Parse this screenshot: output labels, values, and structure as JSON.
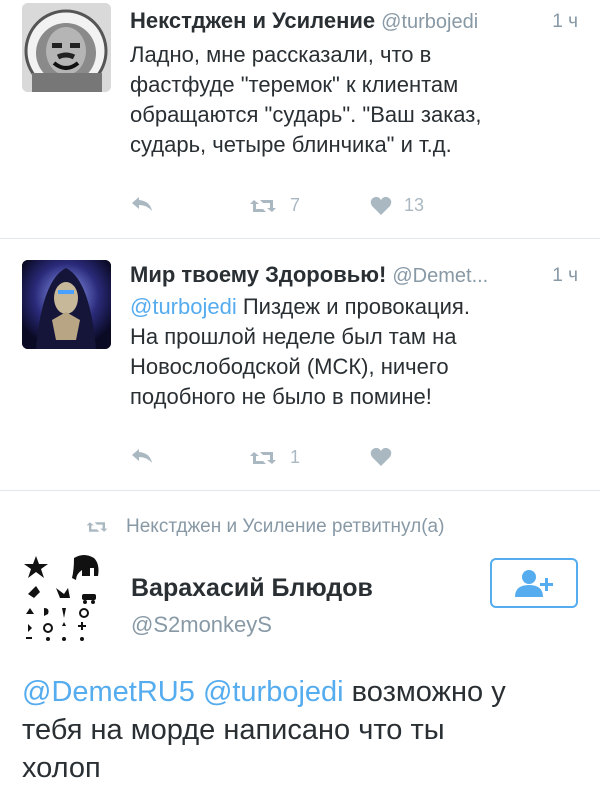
{
  "tweets": [
    {
      "name": "Некстджен и Усиление",
      "handle": "@turbojedi",
      "time": "1 ч",
      "lines": [
        "Ладно, мне рассказали, что в",
        "фастфуде \"теремок\" к клиентам",
        "обращаются \"сударь\". \"Ваш заказ,",
        "сударь, четыре блинчика\" и т.д."
      ],
      "retweets": "7",
      "likes": "13"
    },
    {
      "name": "Мир твоему Здоровью!",
      "handle": "@Demet...",
      "time": "1 ч",
      "lines": [
        "@turbojedi Пиздеж и провокация.",
        "На прошлой неделе был там на",
        "Новослободской (МСК), ничего",
        "подобного не было в помине!"
      ],
      "retweets": "1",
      "likes": ""
    }
  ],
  "retweet_header": "Некстджен и Усиление ретвитнул(а)",
  "featured": {
    "name": "Варахасий Блюдов",
    "handle": "@S2monkeyS",
    "mention1": "@DemetRU5",
    "mention2": "@turbojedi",
    "line1_rest": " возможно у",
    "line2": "тебя на морде написано что ты",
    "line3": "холоп"
  },
  "colors": {
    "accent": "#55acee",
    "muted": "#8899a6",
    "icon": "#aab8c2",
    "text": "#292f33"
  }
}
